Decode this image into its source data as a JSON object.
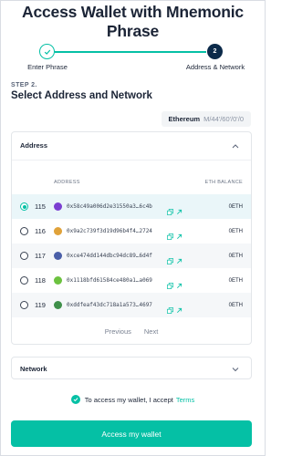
{
  "title": "Access Wallet with Mnemonic Phrase",
  "stepper": {
    "step1_label": "Enter Phrase",
    "step2_number": "2",
    "step2_label": "Address & Network"
  },
  "step": {
    "number": "STEP 2.",
    "heading": "Select Address and Network"
  },
  "derivation": {
    "network": "Ethereum",
    "path": "M/44'/60'/0'/0"
  },
  "address_panel": {
    "title": "Address",
    "col_address": "ADDRESS",
    "col_balance": "ETH BALANCE",
    "rows": [
      {
        "index": "115",
        "address": "0x58c49a006d2e31550a3…6c4b",
        "balance": "0ETH",
        "avatar_color": "#7b3fd1",
        "selected": true
      },
      {
        "index": "116",
        "address": "0x9a2c739f3d19d96b4f4…2724",
        "balance": "0ETH",
        "avatar_color": "#e0a23a",
        "selected": false
      },
      {
        "index": "117",
        "address": "0xce474dd144dbc94dc89…6d4f",
        "balance": "0ETH",
        "avatar_color": "#4a5fa8",
        "selected": false
      },
      {
        "index": "118",
        "address": "0x1118bfd61584ce480a1…a069",
        "balance": "0ETH",
        "avatar_color": "#6cc23f",
        "selected": false
      },
      {
        "index": "119",
        "address": "0xddfeaf43dc718a1a573…4697",
        "balance": "0ETH",
        "avatar_color": "#3f8f4a",
        "selected": false
      }
    ],
    "previous_label": "Previous",
    "next_label": "Next"
  },
  "network_panel": {
    "title": "Network"
  },
  "terms": {
    "text": "To access my wallet, I accept",
    "link": "Terms"
  },
  "access_button": "Access my wallet",
  "colors": {
    "accent": "#05c0a5",
    "step_active": "#0c2a4a",
    "selected_row": "#eaf6f9"
  }
}
